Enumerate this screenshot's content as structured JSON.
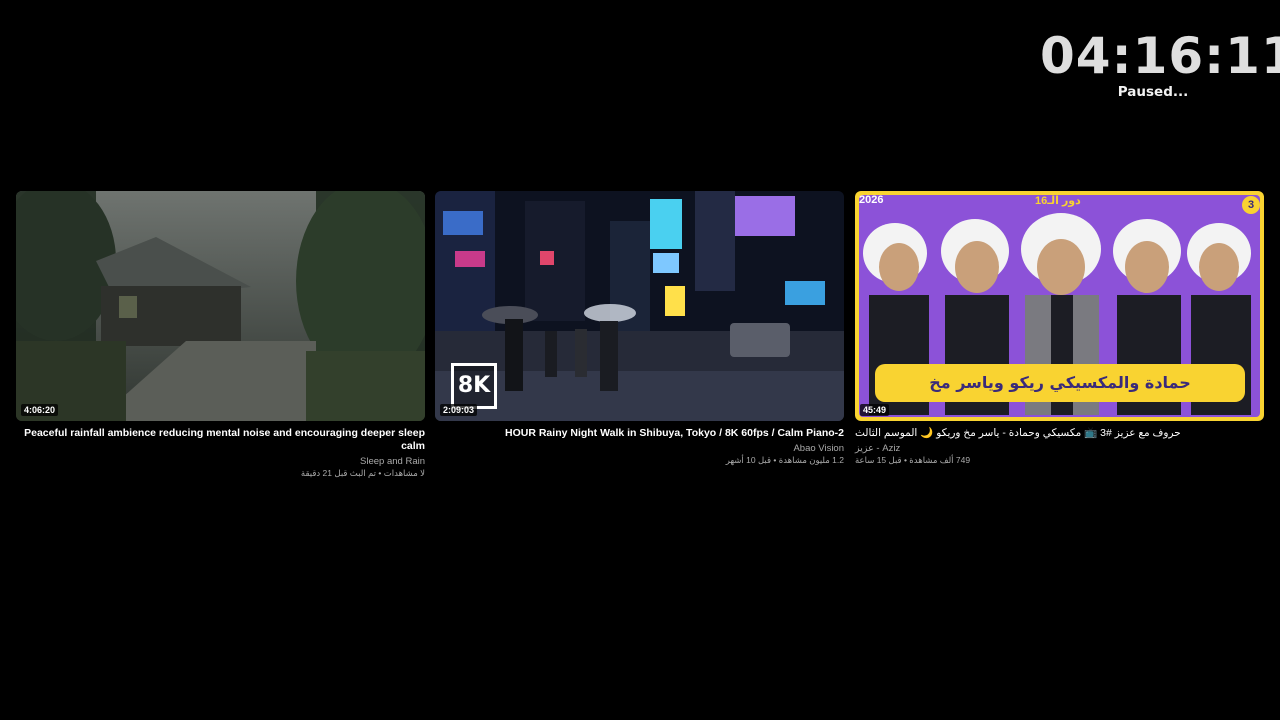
{
  "clock": {
    "time": "04:16:11",
    "status": "Paused..."
  },
  "videos": [
    {
      "title": "Peaceful rainfall ambience reducing mental noise and encouraging deeper sleep calm",
      "channel": "Sleep and Rain",
      "stats": "لا مشاهدات • تم البث قبل 21 دقيقة",
      "duration": "4:06:20"
    },
    {
      "title": "HOUR Rainy Night Walk in Shibuya, Tokyo / 8K 60fps / Calm Piano-2",
      "channel": "Abao Vision",
      "stats": "1.2 مليون مشاهدة • قبل 10 أشهر",
      "duration": "2:09:03",
      "badge": "8K"
    },
    {
      "title": "حروف مع عزيز #3 📺 مكسيكي وحمادة - ياسر مخ وريكو 🌙 الموسم الثالث",
      "channel": "Aziz - عزيز",
      "stats": "749 ألف مشاهدة • قبل 15 ساعة",
      "duration": "45:49",
      "banner": "حمادة والمكسيكي ريكو وياسر مخ",
      "year": "2026",
      "season": "دور الـ16",
      "episode": "3"
    }
  ],
  "colors": {
    "background": "#000000",
    "banner_purple": "#8c52d8",
    "banner_yellow": "#f9d331"
  }
}
